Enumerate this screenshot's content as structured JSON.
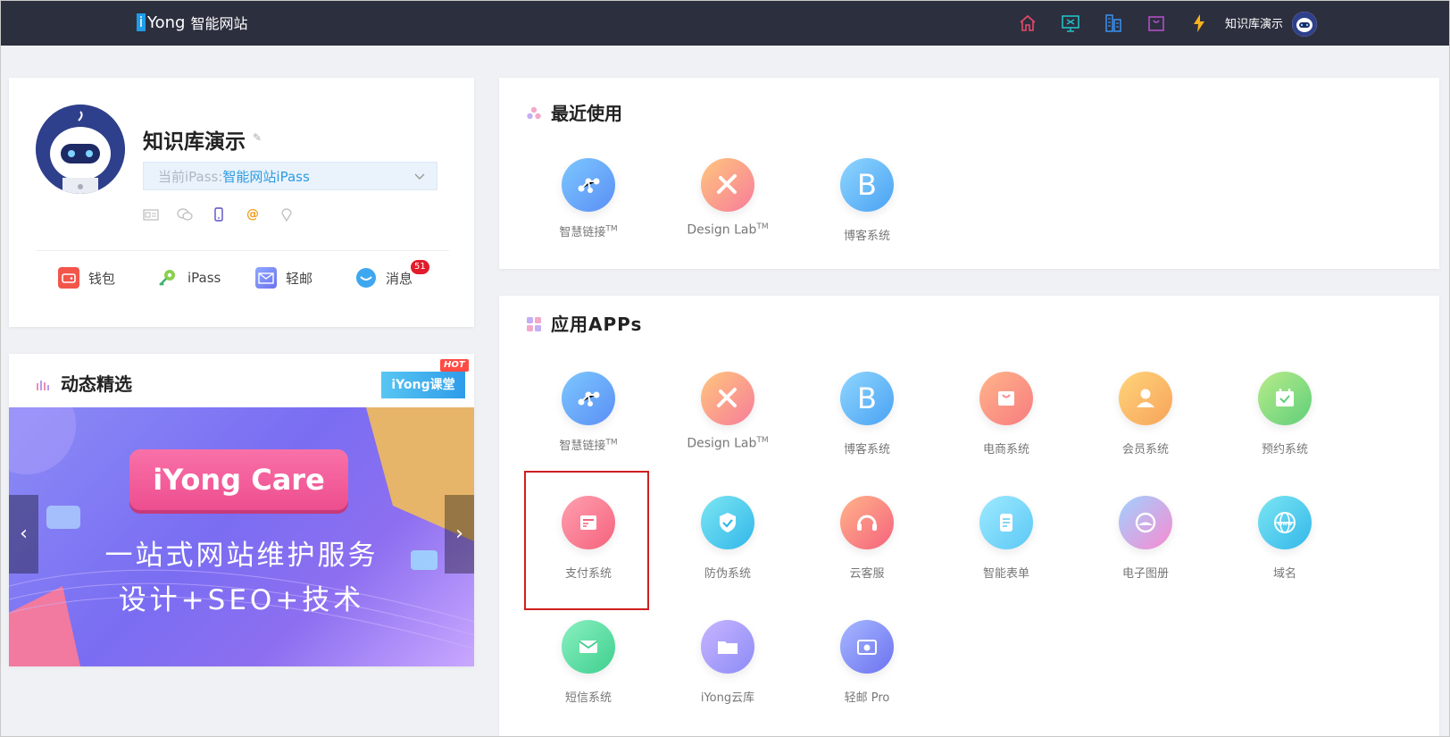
{
  "topbar": {
    "logo_i": "i",
    "logo_brand": "Yong",
    "logo_sub": "智能网站",
    "user_name": "知识库演示"
  },
  "profile": {
    "name": "知识库演示",
    "ipass_label": "当前iPass: ",
    "ipass_value": "智能网站iPass",
    "quick": [
      {
        "label": "钱包"
      },
      {
        "label": "iPass"
      },
      {
        "label": "轻邮"
      },
      {
        "label": "消息",
        "badge": "51"
      }
    ]
  },
  "news": {
    "title": "动态精选",
    "course_badge": "iYong课堂",
    "hot": "HOT",
    "banner_button": "iYong Care",
    "banner_line1": "一站式网站维护服务",
    "banner_line2": "设计+SEO+技术"
  },
  "recent": {
    "title": "最近使用",
    "items": [
      {
        "label": "智慧链接",
        "tm": "TM",
        "color": "#5aa9f5"
      },
      {
        "label": "Design Lab",
        "tm": "TM",
        "color": "#f9a07a"
      },
      {
        "label": "博客系统",
        "tm": "",
        "color": "#4aaaf6"
      }
    ]
  },
  "apps": {
    "title": "应用APPs",
    "items": [
      {
        "label": "智慧链接",
        "tm": "TM"
      },
      {
        "label": "Design Lab",
        "tm": "TM"
      },
      {
        "label": "博客系统",
        "tm": ""
      },
      {
        "label": "电商系统",
        "tm": ""
      },
      {
        "label": "会员系统",
        "tm": ""
      },
      {
        "label": "预约系统",
        "tm": ""
      },
      {
        "label": "支付系统",
        "tm": ""
      },
      {
        "label": "防伪系统",
        "tm": ""
      },
      {
        "label": "云客服",
        "tm": ""
      },
      {
        "label": "智能表单",
        "tm": ""
      },
      {
        "label": "电子图册",
        "tm": ""
      },
      {
        "label": "域名",
        "tm": ""
      },
      {
        "label": "短信系统",
        "tm": ""
      },
      {
        "label": "iYong云库",
        "tm": ""
      },
      {
        "label": "轻邮 Pro",
        "tm": ""
      }
    ]
  }
}
